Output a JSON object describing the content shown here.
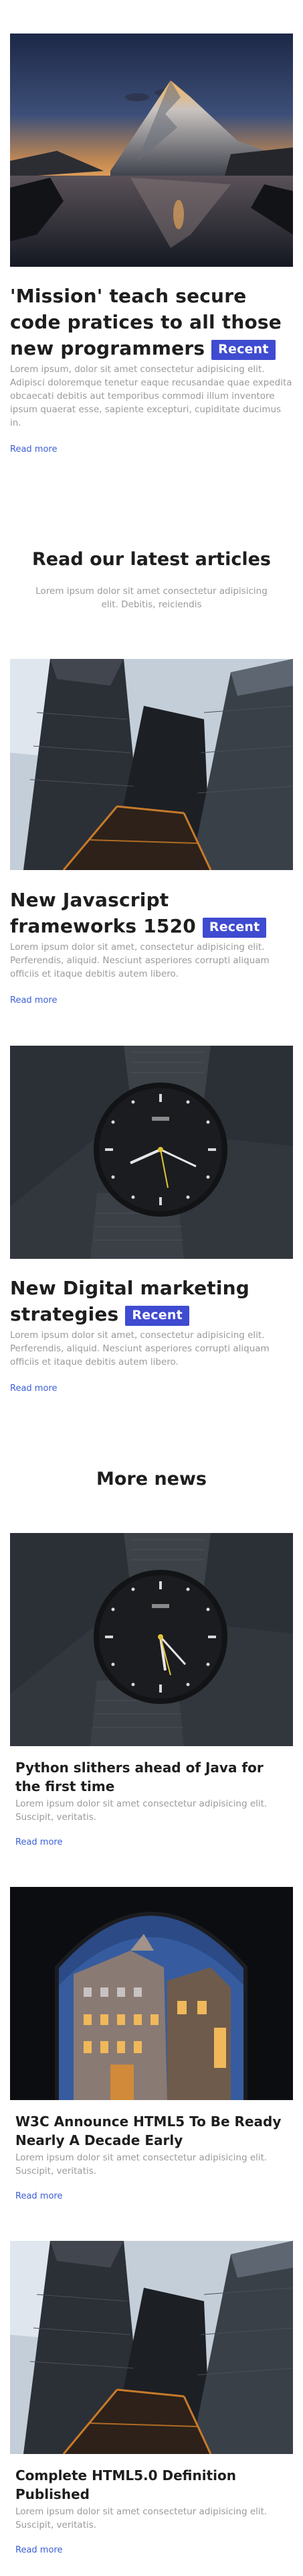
{
  "hero": {
    "title": "'Mission' teach secure code pratices to all those new programmers",
    "badge": "Recent",
    "body": "Lorem ipsum, dolor sit amet consectetur adipisicing elit. Adipisci doloremque tenetur eaque recusandae quae expedita obcaecati debitis aut temporibus commodi illum inventore ipsum quaerat esse, sapiente excepturi, cupiditate ducimus in.",
    "read_more": "Read more"
  },
  "latest": {
    "title": "Read our latest articles",
    "subtitle": "Lorem ipsum dolor sit amet consectetur adipisicing elit. Debitis, reiciendis",
    "articles": [
      {
        "title": "New Javascript frameworks 1520",
        "badge": "Recent",
        "body": "Lorem ipsum dolor sit amet, consectetur adipisicing elit. Perferendis, aliquid. Nesciunt asperiores corrupti aliquam officiis et itaque debitis autem libero.",
        "read_more": "Read more"
      },
      {
        "title": "New Digital marketing strategies",
        "badge": "Recent",
        "body": "Lorem ipsum dolor sit amet, consectetur adipisicing elit. Perferendis, aliquid. Nesciunt asperiores corrupti aliquam officiis et itaque debitis autem libero.",
        "read_more": "Read more"
      }
    ]
  },
  "more_news": {
    "title": "More news",
    "items": [
      {
        "title": "Python slithers ahead of Java for the first time",
        "body": "Lorem ipsum dolor sit amet consectetur adipisicing elit. Suscipit, veritatis.",
        "read_more": "Read more"
      },
      {
        "title": "W3C Announce HTML5 To Be Ready Nearly A Decade Early",
        "body": "Lorem ipsum dolor sit amet consectetur adipisicing elit. Suscipit, veritatis.",
        "read_more": "Read more"
      },
      {
        "title": "Complete HTML5.0 Definition Published",
        "body": "Lorem ipsum dolor sit amet consectetur adipisicing elit. Suscipit, veritatis.",
        "read_more": "Read more"
      }
    ]
  },
  "colors": {
    "accent": "#3f4bd0",
    "link": "#3b5fd6",
    "muted_text": "#9a9a9a",
    "heading": "#1e1e1e"
  }
}
